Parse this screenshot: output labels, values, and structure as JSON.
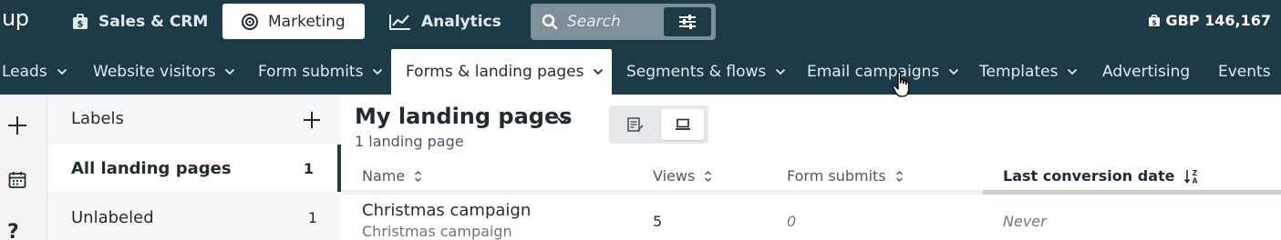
{
  "app": {
    "logo": "up"
  },
  "topnav": {
    "items": [
      {
        "label": "Sales & CRM",
        "icon": "briefcase-dollar-icon"
      },
      {
        "label": "Marketing",
        "icon": "target-icon",
        "active": true
      },
      {
        "label": "Analytics",
        "icon": "line-chart-icon"
      }
    ],
    "search": {
      "placeholder": "Search"
    },
    "balance": "GBP 146,167"
  },
  "subnav": {
    "items": [
      {
        "label": "Leads",
        "dropdown": true
      },
      {
        "label": "Website visitors",
        "dropdown": true
      },
      {
        "label": "Form submits",
        "dropdown": true
      },
      {
        "label": "Forms & landing pages",
        "dropdown": true,
        "active": true
      },
      {
        "label": "Segments & flows",
        "dropdown": true
      },
      {
        "label": "Email campaigns",
        "dropdown": true
      },
      {
        "label": "Templates",
        "dropdown": true
      },
      {
        "label": "Advertising",
        "dropdown": false
      },
      {
        "label": "Events",
        "dropdown": false
      }
    ]
  },
  "rail": {
    "help": "?"
  },
  "labels": {
    "title": "Labels",
    "items": [
      {
        "label": "All landing pages",
        "count": "1",
        "active": true
      },
      {
        "label": "Unlabeled",
        "count": "1"
      }
    ]
  },
  "main": {
    "title": "My landing pages",
    "subtitle": "1 landing page",
    "columns": [
      {
        "label": "Name"
      },
      {
        "label": "Views"
      },
      {
        "label": "Form submits"
      },
      {
        "label": "Last conversion date",
        "sorted": true
      }
    ],
    "rows": [
      {
        "name": "Christmas campaign",
        "subname": "Christmas campaign",
        "views": "5",
        "form_submits": "0",
        "last_conversion": "Never"
      }
    ]
  },
  "colors": {
    "nav_bg": "#1d3a47",
    "active_bg": "#ffffff",
    "search_bg": "#7d8f98"
  }
}
